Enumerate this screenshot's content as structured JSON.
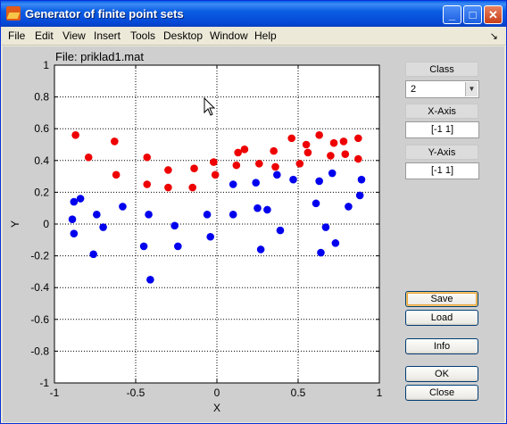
{
  "window": {
    "title": "Generator of finite point sets"
  },
  "menu": {
    "items": [
      "File",
      "Edit",
      "View",
      "Insert",
      "Tools",
      "Desktop",
      "Window",
      "Help"
    ],
    "dock": "↘"
  },
  "file_label": "File: priklad1.mat",
  "side": {
    "class_label": "Class",
    "class_value": "2",
    "xaxis_label": "X-Axis",
    "xaxis_value": "[-1 1]",
    "yaxis_label": "Y-Axis",
    "yaxis_value": "[-1 1]",
    "buttons": {
      "save": "Save",
      "load": "Load",
      "info": "Info",
      "ok": "OK",
      "close": "Close"
    }
  },
  "chart_data": {
    "type": "scatter",
    "title": "",
    "xlabel": "X",
    "ylabel": "Y",
    "xlim": [
      -1,
      1
    ],
    "ylim": [
      -1,
      1
    ],
    "xticks": [
      "-1",
      "-0.5",
      "0",
      "0.5",
      "1"
    ],
    "yticks": [
      "1",
      "0.8",
      "0.6",
      "0.4",
      "0.2",
      "0",
      "-0.2",
      "-0.4",
      "-0.6",
      "-0.8",
      "-1"
    ],
    "grid": "dotted",
    "series": [
      {
        "color": "#ee0000",
        "points": [
          [
            -0.87,
            0.56
          ],
          [
            -0.79,
            0.42
          ],
          [
            -0.63,
            0.52
          ],
          [
            -0.62,
            0.31
          ],
          [
            -0.43,
            0.42
          ],
          [
            -0.43,
            0.25
          ],
          [
            -0.3,
            0.34
          ],
          [
            -0.3,
            0.23
          ],
          [
            -0.14,
            0.35
          ],
          [
            -0.15,
            0.23
          ],
          [
            -0.02,
            0.39
          ],
          [
            -0.01,
            0.31
          ],
          [
            0.12,
            0.37
          ],
          [
            0.13,
            0.45
          ],
          [
            0.17,
            0.47
          ],
          [
            0.26,
            0.38
          ],
          [
            0.35,
            0.46
          ],
          [
            0.36,
            0.36
          ],
          [
            0.46,
            0.54
          ],
          [
            0.51,
            0.38
          ],
          [
            0.55,
            0.5
          ],
          [
            0.56,
            0.45
          ],
          [
            0.63,
            0.56
          ],
          [
            0.7,
            0.43
          ],
          [
            0.72,
            0.51
          ],
          [
            0.78,
            0.52
          ],
          [
            0.79,
            0.44
          ],
          [
            0.87,
            0.54
          ],
          [
            0.87,
            0.41
          ]
        ]
      },
      {
        "color": "#0000ee",
        "points": [
          [
            -0.88,
            0.14
          ],
          [
            -0.89,
            0.03
          ],
          [
            -0.88,
            -0.06
          ],
          [
            -0.84,
            0.16
          ],
          [
            -0.76,
            -0.19
          ],
          [
            -0.74,
            0.06
          ],
          [
            -0.7,
            -0.02
          ],
          [
            -0.58,
            0.11
          ],
          [
            -0.45,
            -0.14
          ],
          [
            -0.42,
            0.06
          ],
          [
            -0.41,
            -0.35
          ],
          [
            -0.26,
            -0.01
          ],
          [
            -0.24,
            -0.14
          ],
          [
            -0.06,
            0.06
          ],
          [
            -0.04,
            -0.08
          ],
          [
            0.1,
            0.25
          ],
          [
            0.1,
            0.06
          ],
          [
            0.24,
            0.26
          ],
          [
            0.25,
            0.1
          ],
          [
            0.27,
            -0.16
          ],
          [
            0.31,
            0.09
          ],
          [
            0.37,
            0.31
          ],
          [
            0.39,
            -0.04
          ],
          [
            0.47,
            0.28
          ],
          [
            0.61,
            0.13
          ],
          [
            0.63,
            0.27
          ],
          [
            0.64,
            -0.18
          ],
          [
            0.67,
            -0.02
          ],
          [
            0.71,
            0.32
          ],
          [
            0.73,
            -0.12
          ],
          [
            0.81,
            0.11
          ],
          [
            0.88,
            0.18
          ],
          [
            0.89,
            0.28
          ]
        ]
      }
    ]
  }
}
